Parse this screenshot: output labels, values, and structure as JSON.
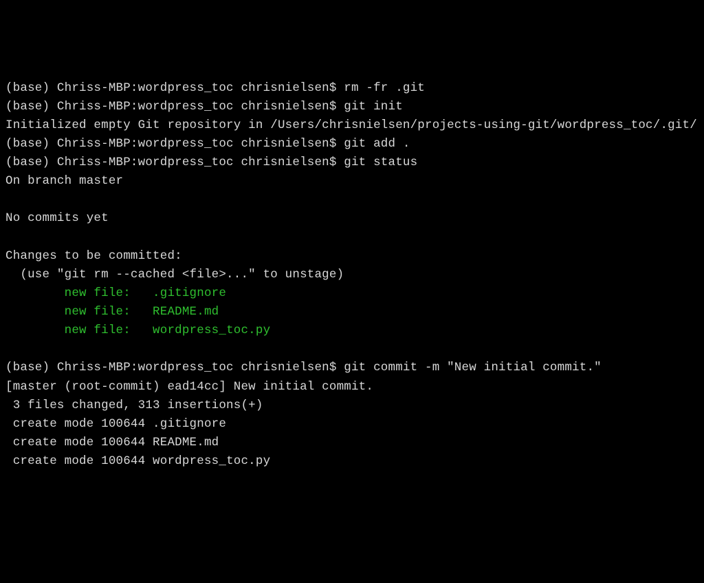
{
  "prompt": "(base) Chriss-MBP:wordpress_toc chrisnielsen$",
  "commands": {
    "rm": "rm -fr .git",
    "init": "git init",
    "add": "git add .",
    "status": "git status",
    "commit": "git commit -m \"New initial commit.\""
  },
  "output": {
    "init": "Initialized empty Git repository in /Users/chrisnielsen/projects-using-git/wordpress_toc/.git/",
    "status_branch": "On branch master",
    "status_nocommits": "No commits yet",
    "status_changes_header": "Changes to be committed:",
    "status_unstage_hint": "  (use \"git rm --cached <file>...\" to unstage)",
    "status_newfile_prefix": "        new file:   ",
    "status_files": [
      ".gitignore",
      "README.md",
      "wordpress_toc.py"
    ],
    "commit_result": "[master (root-commit) ead14cc] New initial commit.",
    "commit_stats": " 3 files changed, 313 insertions(+)",
    "commit_create_prefix": " create mode 100644 ",
    "commit_files": [
      ".gitignore",
      "README.md",
      "wordpress_toc.py"
    ]
  }
}
